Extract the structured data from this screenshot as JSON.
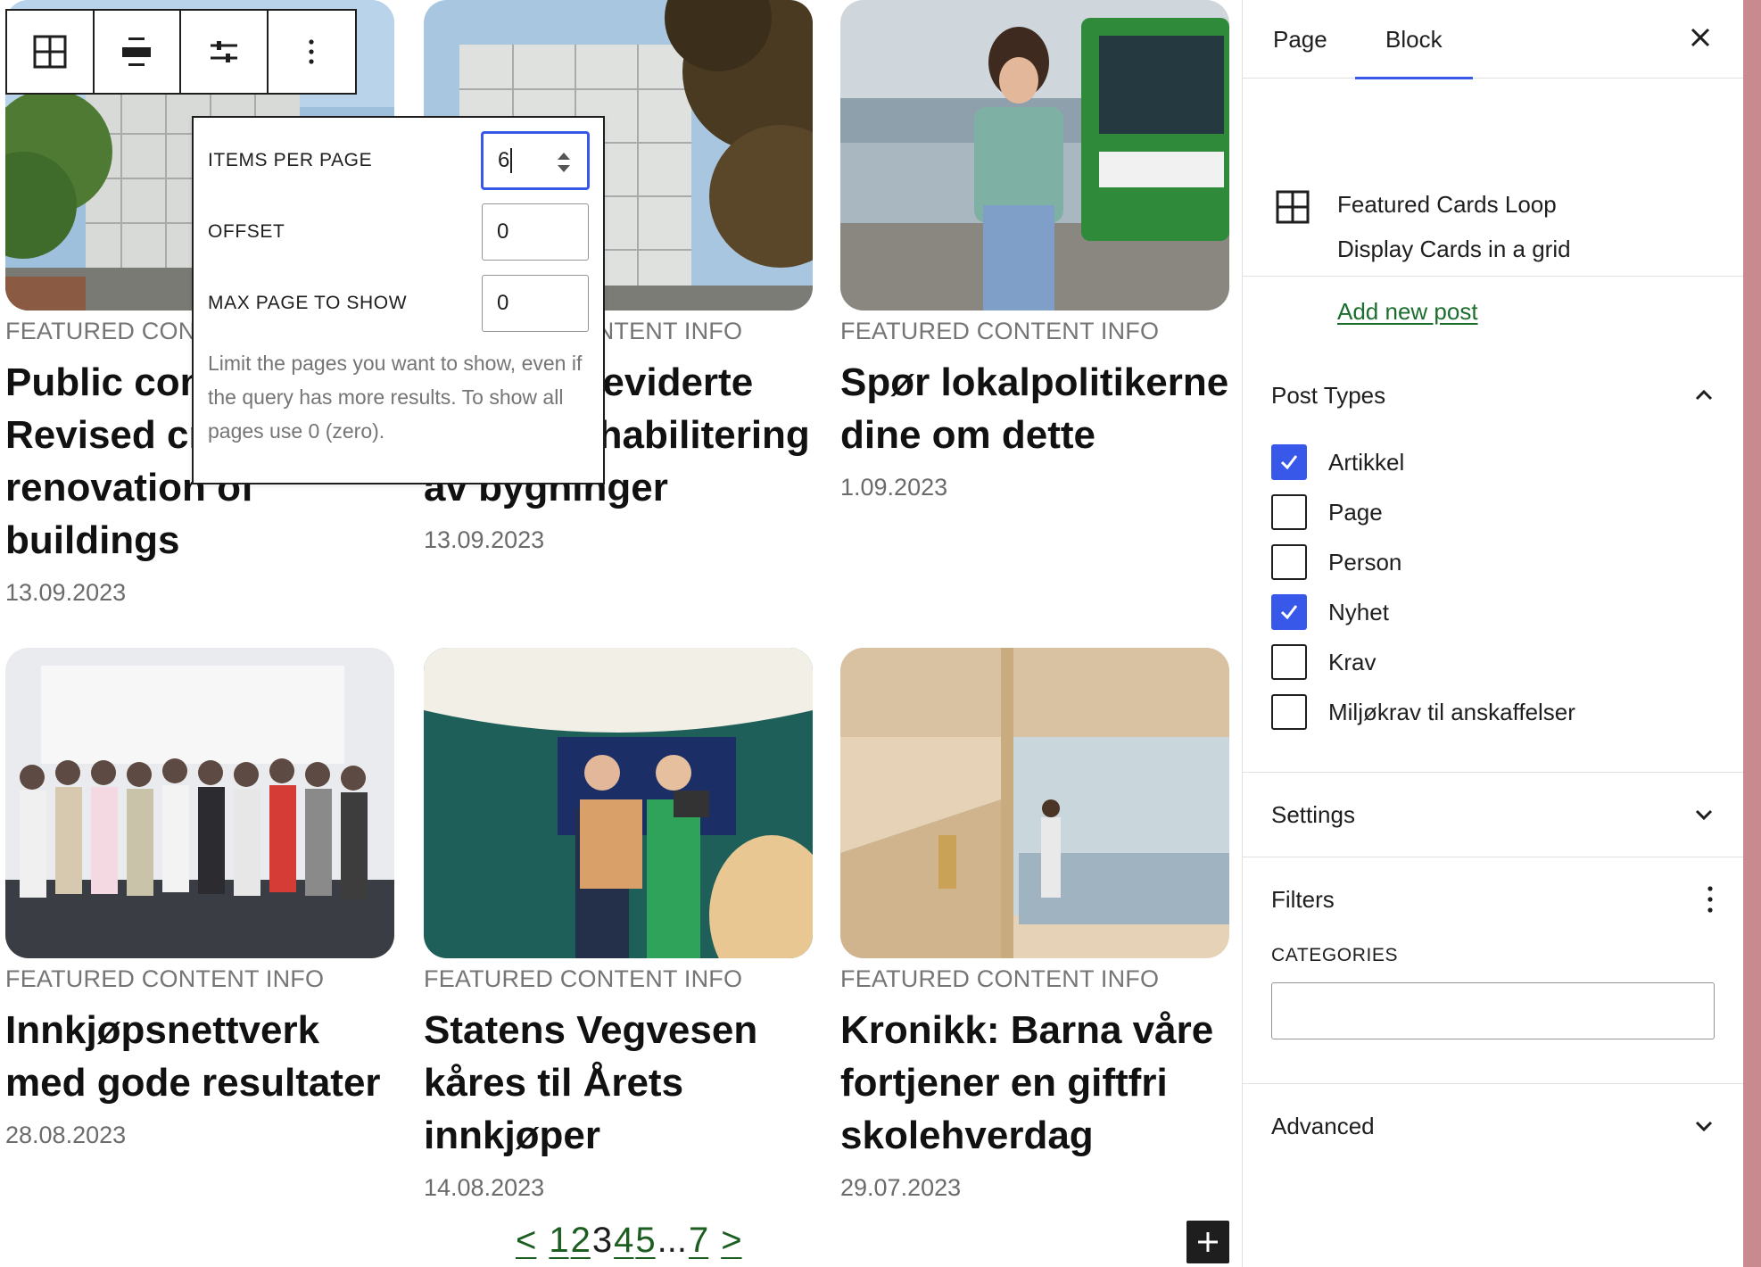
{
  "toolbar": {
    "buttons": [
      {
        "icon": "grid-icon"
      },
      {
        "icon": "align-icon"
      },
      {
        "icon": "sliders-icon"
      },
      {
        "icon": "more-vertical-icon"
      }
    ]
  },
  "popover": {
    "items_per_page": {
      "label": "ITEMS PER PAGE",
      "value": "6"
    },
    "offset": {
      "label": "OFFSET",
      "value": "0"
    },
    "max_page": {
      "label": "MAX PAGE TO SHOW",
      "value": "0"
    },
    "help": "Limit the pages you want to show, even if the query has more results. To show all pages use 0 (zero)."
  },
  "cards": [
    {
      "eyebrow": "FEATURED CONTENT INFO",
      "title": "Public consultation: Revised criteria for renovation of buildings",
      "date": "13.09.2023"
    },
    {
      "eyebrow": "FEATURED CONTENT INFO",
      "title": "Høring: Reviderte krav til rehabilitering av bygninger",
      "date": "13.09.2023"
    },
    {
      "eyebrow": "FEATURED CONTENT INFO",
      "title": "Spør lokalpolitikerne dine om dette",
      "date": "1.09.2023"
    },
    {
      "eyebrow": "FEATURED CONTENT INFO",
      "title": "Innkjøpsnettverk med gode resultater",
      "date": "28.08.2023"
    },
    {
      "eyebrow": "FEATURED CONTENT INFO",
      "title": "Statens Vegvesen kåres til Årets innkjøper",
      "date": "14.08.2023"
    },
    {
      "eyebrow": "FEATURED CONTENT INFO",
      "title": "Kronikk: Barna våre fortjener en giftfri skolehverdag",
      "date": "29.07.2023"
    }
  ],
  "pagination": {
    "prev": "<",
    "pages": [
      "1",
      "2",
      "3",
      "4",
      "5"
    ],
    "current": "3",
    "ellipsis": "...",
    "last": "7",
    "next": ">"
  },
  "sidebar": {
    "tabs": [
      "Page",
      "Block"
    ],
    "active_tab": "Block",
    "block": {
      "title": "Featured Cards Loop",
      "description": "Display Cards in a grid",
      "add_link": "Add new post"
    },
    "post_types": {
      "title": "Post Types",
      "options": [
        {
          "label": "Artikkel",
          "checked": true
        },
        {
          "label": "Page",
          "checked": false
        },
        {
          "label": "Person",
          "checked": false
        },
        {
          "label": "Nyhet",
          "checked": true
        },
        {
          "label": "Krav",
          "checked": false
        },
        {
          "label": "Miljøkrav til anskaffelser",
          "checked": false
        }
      ]
    },
    "settings_title": "Settings",
    "filters": {
      "title": "Filters",
      "categories_label": "CATEGORIES",
      "categories_value": ""
    },
    "advanced_title": "Advanced"
  },
  "colors": {
    "accent": "#3858e9",
    "link": "#1b6e2d",
    "strip": "#c98a8f"
  }
}
